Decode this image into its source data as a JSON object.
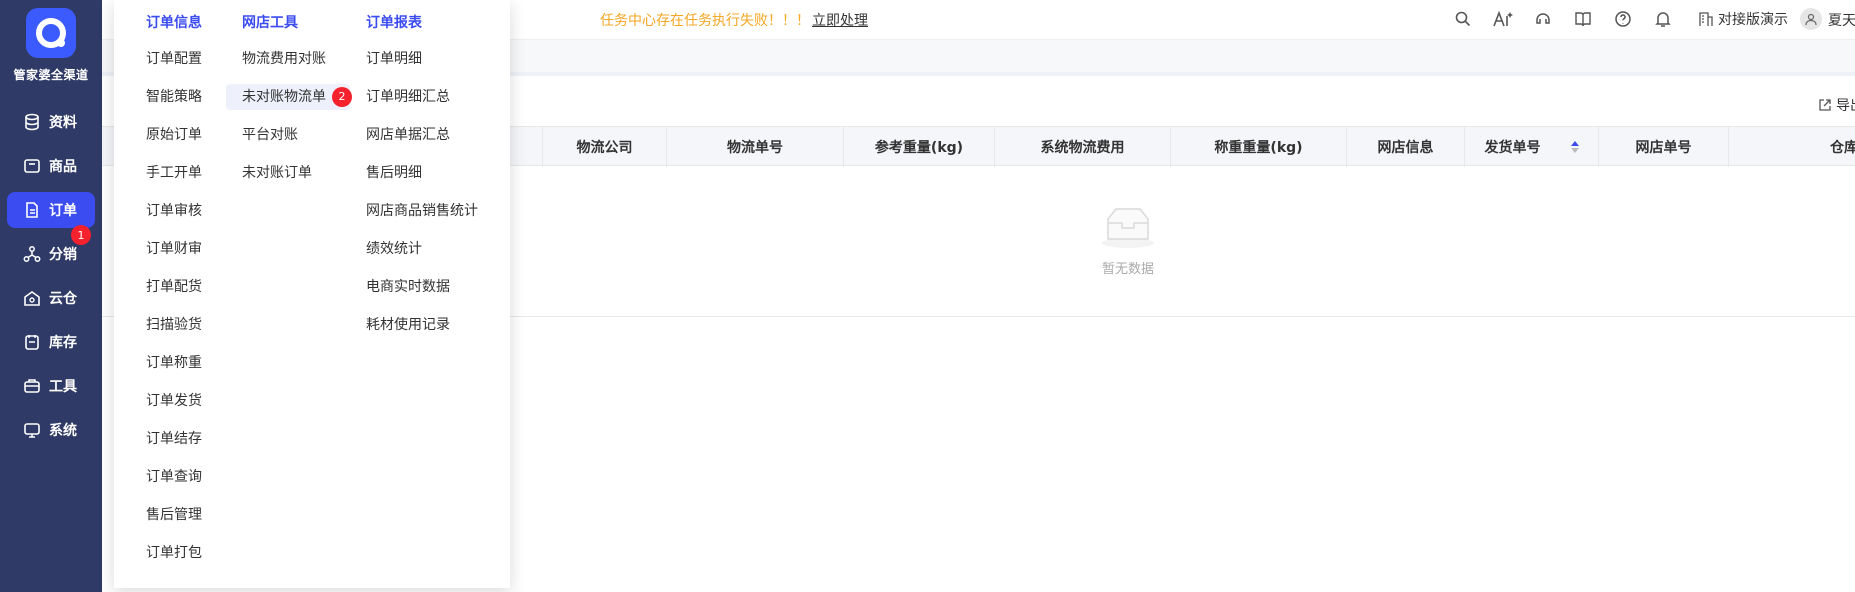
{
  "brand": {
    "name": "管家婆全渠道"
  },
  "sidebar": {
    "items": [
      {
        "label": "资料",
        "icon": "database-icon"
      },
      {
        "label": "商品",
        "icon": "goods-icon"
      },
      {
        "label": "订单",
        "icon": "order-icon",
        "active": true,
        "badge": "1"
      },
      {
        "label": "分销",
        "icon": "distribution-icon"
      },
      {
        "label": "云仓",
        "icon": "cloud-warehouse-icon"
      },
      {
        "label": "库存",
        "icon": "inventory-icon"
      },
      {
        "label": "工具",
        "icon": "toolbox-icon"
      },
      {
        "label": "系统",
        "icon": "monitor-icon"
      }
    ]
  },
  "header": {
    "alert_text": "任务中心存在任务执行失败！！！",
    "alert_link": "立即处理",
    "environment": "对接版演示",
    "username": "夏天"
  },
  "toolbar": {
    "export_label": "导出"
  },
  "menu": {
    "columns": [
      {
        "title": "订单信息",
        "items": [
          "订单配置",
          "智能策略",
          "原始订单",
          "手工开单",
          "订单审核",
          "订单财审",
          "打单配货",
          "扫描验货",
          "订单称重",
          "订单发货",
          "订单结存",
          "订单查询",
          "售后管理",
          "订单打包"
        ]
      },
      {
        "title": "网店工具",
        "items": [
          "物流费用对账",
          "未对账物流单",
          "平台对账",
          "未对账订单"
        ],
        "highlight_index": 1,
        "badge": "2"
      },
      {
        "title": "订单报表",
        "items": [
          "订单明细",
          "订单明细汇总",
          "网店单据汇总",
          "售后明细",
          "网店商品销售统计",
          "绩效统计",
          "电商实时数据",
          "耗材使用记录"
        ]
      }
    ]
  },
  "table": {
    "columns": [
      "物流公司",
      "物流单号",
      "参考重量(kg)",
      "系统物流费用",
      "称重重量(kg)",
      "网店信息",
      "发货单号",
      "网店单号",
      "仓库"
    ],
    "sorted_column": "发货单号",
    "empty_text": "暂无数据"
  },
  "colors": {
    "sidebar_bg": "#2f3a66",
    "accent": "#3b4cf0",
    "alert": "#f5a623",
    "badge": "#f5222d"
  }
}
